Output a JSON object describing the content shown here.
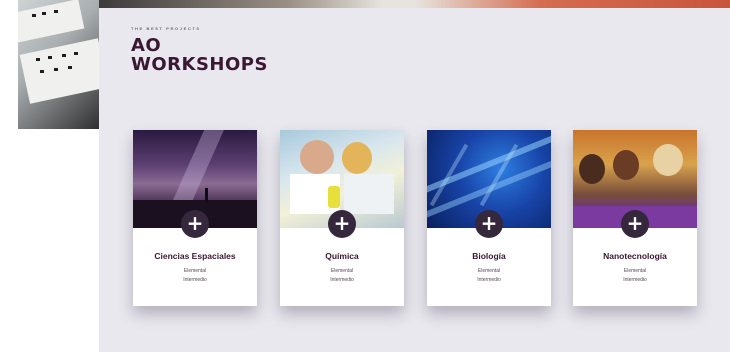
{
  "header": {
    "eyebrow": "THE BEST PROJECTS",
    "title_line1": "AO",
    "title_line2": "WORKSHOPS"
  },
  "cards": [
    {
      "name": "Ciencias Espaciales",
      "level1": "Elemental",
      "level2": "Intermedio",
      "icon": "plus-icon"
    },
    {
      "name": "Química",
      "level1": "Elemental",
      "level2": "Intermedio",
      "icon": "plus-icon"
    },
    {
      "name": "Biología",
      "level1": "Elemental",
      "level2": "Intermedio",
      "icon": "plus-icon"
    },
    {
      "name": "Nanotecnología",
      "level1": "Elemental",
      "level2": "Intermedio",
      "icon": "plus-icon"
    }
  ],
  "colors": {
    "background": "#e9e8ee",
    "title": "#3a1733",
    "plus_button": "#36283c",
    "card": "#ffffff"
  }
}
